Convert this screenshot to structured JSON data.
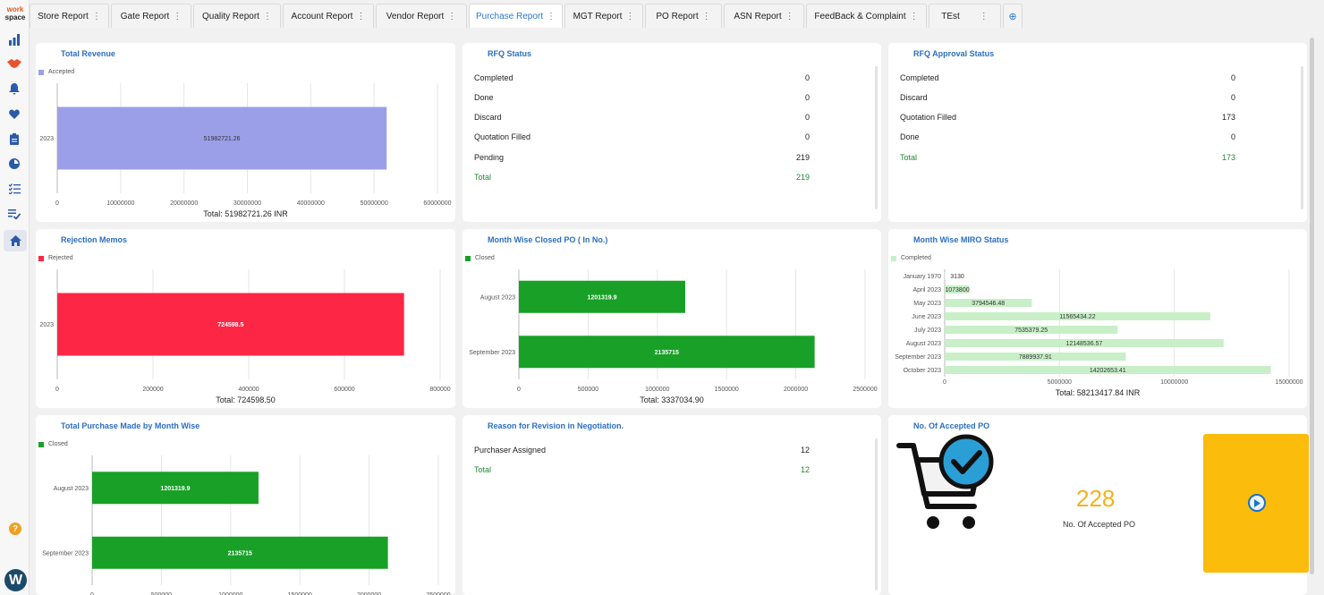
{
  "logo": {
    "line1": "work",
    "line2": "space"
  },
  "sidebar": {
    "icons": [
      "bar-chart-icon",
      "handshake-icon",
      "bell-icon",
      "heart-icon",
      "clipboard-icon",
      "pie-icon",
      "checklist-icon",
      "list-check-icon",
      "home-icon"
    ],
    "avatar_letter": "W",
    "help_glyph": "?"
  },
  "tabs": [
    {
      "label": "Store Report",
      "dots": "⋮"
    },
    {
      "label": "Gate Report",
      "dots": "⋮"
    },
    {
      "label": "Quality Report",
      "dots": "⋮"
    },
    {
      "label": "Account Report",
      "dots": "⋮"
    },
    {
      "label": "Vendor Report",
      "dots": "⋮"
    },
    {
      "label": "Purchase Report",
      "dots": "⋮"
    },
    {
      "label": "MGT Report",
      "dots": "⋮"
    },
    {
      "label": "PO Report",
      "dots": "⋮"
    },
    {
      "label": "ASN Report",
      "dots": "⋮"
    },
    {
      "label": "FeedBack & Complaint",
      "dots": "⋮"
    },
    {
      "label": "TEst",
      "dots": "⋮"
    }
  ],
  "tab_add": "⊕",
  "cards": {
    "total_revenue": {
      "title": "Total Revenue",
      "legend": "Accepted",
      "total": "Total: 51982721.26 INR"
    },
    "rfq_status": {
      "title": "RFQ Status",
      "rows": [
        {
          "label": "Completed",
          "value": "0"
        },
        {
          "label": "Done",
          "value": "0"
        },
        {
          "label": "Discard",
          "value": "0"
        },
        {
          "label": "Quotation Filled",
          "value": "0"
        },
        {
          "label": "Pending",
          "value": "219"
        }
      ],
      "total": {
        "label": "Total",
        "value": "219"
      }
    },
    "rfq_approval": {
      "title": "RFQ Approval Status",
      "rows": [
        {
          "label": "Completed",
          "value": "0"
        },
        {
          "label": "Discard",
          "value": "0"
        },
        {
          "label": "Quotation Filled",
          "value": "173"
        },
        {
          "label": "Done",
          "value": "0"
        }
      ],
      "total": {
        "label": "Total",
        "value": "173"
      }
    },
    "rejection_memos": {
      "title": "Rejection Memos",
      "legend": "Rejected",
      "total": "Total: 724598.50"
    },
    "month_closed_po": {
      "title": "Month Wise Closed PO ( In No.)",
      "legend": "Closed",
      "total": "Total: 3337034.90"
    },
    "miro_status": {
      "title": "Month Wise MIRO Status",
      "legend": "Completed",
      "total": "Total: 58213417.84 INR"
    },
    "purchase_month": {
      "title": "Total Purchase Made by Month Wise",
      "legend": "Closed"
    },
    "revision_reason": {
      "title": "Reason for Revision in Negotiation.",
      "rows": [
        {
          "label": "Purchaser Assigned",
          "value": "12"
        }
      ],
      "total": {
        "label": "Total",
        "value": "12"
      }
    },
    "accepted_po": {
      "title": "No. Of Accepted PO",
      "value": "228",
      "label": "No. Of Accepted PO"
    }
  },
  "chart_data": [
    {
      "type": "bar",
      "title": "Total Revenue",
      "orientation": "horizontal",
      "categories": [
        "2023"
      ],
      "values": [
        51982721.26
      ],
      "value_labels": [
        "51982721.26"
      ],
      "series": [
        {
          "name": "Accepted",
          "values": [
            51982721.26
          ]
        }
      ],
      "xlim": [
        0,
        60000000
      ],
      "ticks": [
        "0",
        "10000000",
        "20000000",
        "30000000",
        "40000000",
        "50000000",
        "60000000"
      ],
      "color": "#9b9fe8"
    },
    {
      "type": "bar",
      "title": "Rejection Memos",
      "orientation": "horizontal",
      "categories": [
        "2023"
      ],
      "values": [
        724598.5
      ],
      "value_labels": [
        "724598.5"
      ],
      "series": [
        {
          "name": "Rejected",
          "values": [
            724598.5
          ]
        }
      ],
      "xlim": [
        0,
        800000
      ],
      "ticks": [
        "0",
        "200000",
        "400000",
        "600000",
        "800000"
      ],
      "color": "#fe2645"
    },
    {
      "type": "bar",
      "title": "Month Wise Closed PO ( In No.)",
      "orientation": "horizontal",
      "categories": [
        "August 2023",
        "September 2023"
      ],
      "values": [
        1201319.9,
        2135715
      ],
      "value_labels": [
        "1201319.9",
        "2135715"
      ],
      "series": [
        {
          "name": "Closed",
          "values": [
            1201319.9,
            2135715
          ]
        }
      ],
      "xlim": [
        0,
        2500000
      ],
      "ticks": [
        "0",
        "500000",
        "1000000",
        "1500000",
        "2000000",
        "2500000"
      ],
      "color": "#18a027"
    },
    {
      "type": "bar",
      "title": "Month Wise MIRO Status",
      "orientation": "horizontal",
      "categories": [
        "January 1970",
        "April 2023",
        "May 2023",
        "June 2023",
        "July 2023",
        "August 2023",
        "September 2023",
        "October 2023"
      ],
      "values": [
        3130,
        1073800,
        3794546.48,
        11565434.22,
        7535379.25,
        12148536.57,
        7889937.91,
        14202653.41
      ],
      "value_labels": [
        "3130",
        "1073800",
        "3794546.48",
        "11565434.22",
        "7535379.25",
        "12148536.57",
        "7889937.91",
        "14202653.41"
      ],
      "series": [
        {
          "name": "Completed",
          "values": [
            3130,
            1073800,
            3794546.48,
            11565434.22,
            7535379.25,
            12148536.57,
            7889937.91,
            14202653.41
          ]
        }
      ],
      "xlim": [
        0,
        15000000
      ],
      "ticks": [
        "0",
        "5000000",
        "10000000",
        "15000000"
      ],
      "color": "#c8efc8"
    },
    {
      "type": "bar",
      "title": "Total Purchase Made by Month Wise",
      "orientation": "horizontal",
      "categories": [
        "August 2023",
        "September 2023"
      ],
      "values": [
        1201319.9,
        2135715
      ],
      "value_labels": [
        "1201319.9",
        "2135715"
      ],
      "series": [
        {
          "name": "Closed",
          "values": [
            1201319.9,
            2135715
          ]
        }
      ],
      "xlim": [
        0,
        2500000
      ],
      "ticks": [
        "0",
        "500000",
        "1000000",
        "1500000",
        "2000000",
        "2500000"
      ],
      "color": "#18a027"
    }
  ]
}
